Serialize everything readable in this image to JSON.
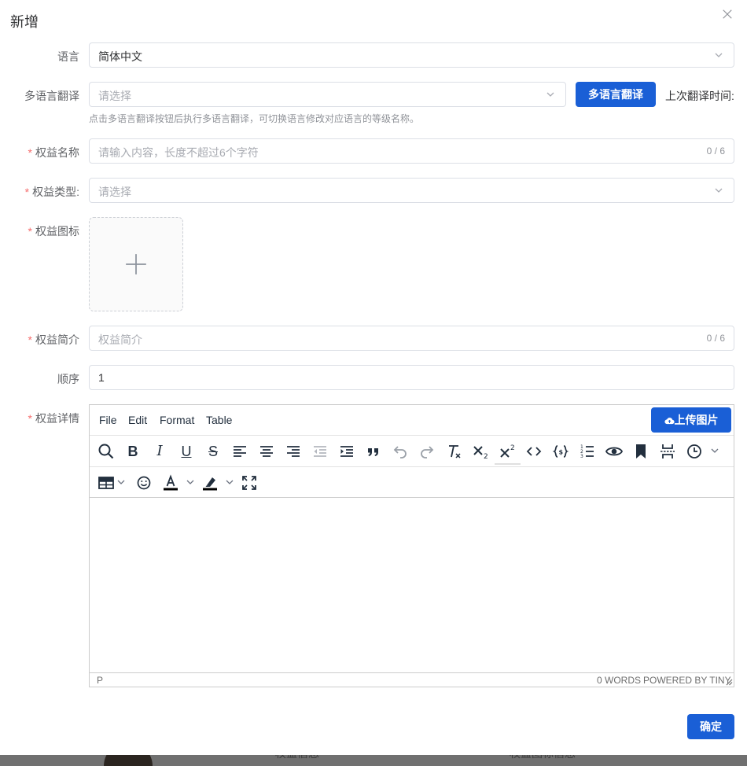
{
  "dialog": {
    "title": "新增",
    "confirm_label": "确定"
  },
  "form": {
    "language": {
      "label": "语言",
      "value": "简体中文"
    },
    "translation": {
      "label": "多语言翻译",
      "placeholder": "请选择",
      "button_label": "多语言翻译",
      "last_time_label": "上次翻译时间:",
      "hint": "点击多语言翻译按钮后执行多语言翻译，可切换语言修改对应语言的等级名称。"
    },
    "benefit_name": {
      "label": "权益名称",
      "placeholder": "请输入内容，长度不超过6个字符",
      "count": "0 / 6"
    },
    "benefit_type": {
      "label": "权益类型:",
      "placeholder": "请选择"
    },
    "benefit_icon": {
      "label": "权益图标"
    },
    "benefit_intro": {
      "label": "权益简介",
      "placeholder": "权益简介",
      "count": "0 / 6"
    },
    "order": {
      "label": "顺序",
      "value": "1"
    },
    "benefit_detail": {
      "label": "权益详情"
    }
  },
  "editor": {
    "menus": [
      "File",
      "Edit",
      "Format",
      "Table"
    ],
    "upload_image_label": "上传图片",
    "status_path": "P",
    "word_count": "0 WORDS",
    "powered_by": "POWERED BY TINY"
  },
  "background": {
    "text_left": "权益信息",
    "text_right": "权益图标信息"
  },
  "colors": {
    "primary": "#1a5fd6",
    "required": "#f56c6c",
    "border": "#dcdfe6",
    "placeholder": "#a8abb2"
  }
}
